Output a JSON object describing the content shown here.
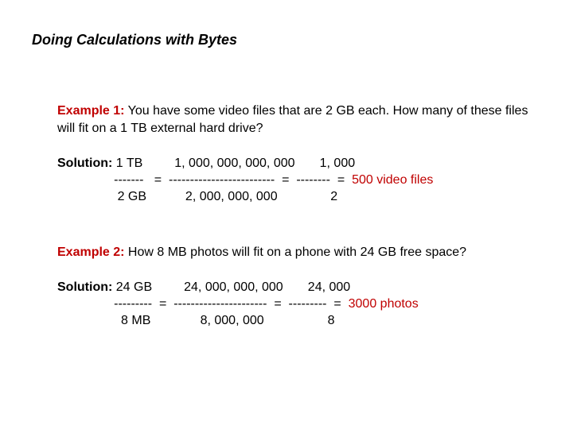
{
  "title": "Doing Calculations with Bytes",
  "ex1": {
    "heading": "Example 1:",
    "question": "  You have some video files that are 2 GB each.  How many of these files will fit on a 1 TB external hard drive?",
    "solution_label": "Solution:",
    "line1": " 1 TB         1, 000, 000, 000, 000       1, 000",
    "line2": "                -------   =  -------------------------  =  --------  =  ",
    "answer": "500 video files",
    "line3": "                 2 GB           2, 000, 000, 000               2"
  },
  "ex2": {
    "heading": "Example 2:",
    "question": "  How 8 MB photos will fit on a phone with 24 GB free space?",
    "solution_label": "Solution:",
    "line1": " 24 GB         24, 000, 000, 000       24, 000",
    "line2": "                ---------  =  ----------------------  =  ---------  =  ",
    "answer": "3000 photos",
    "line3": "                  8 MB              8, 000, 000                  8"
  }
}
